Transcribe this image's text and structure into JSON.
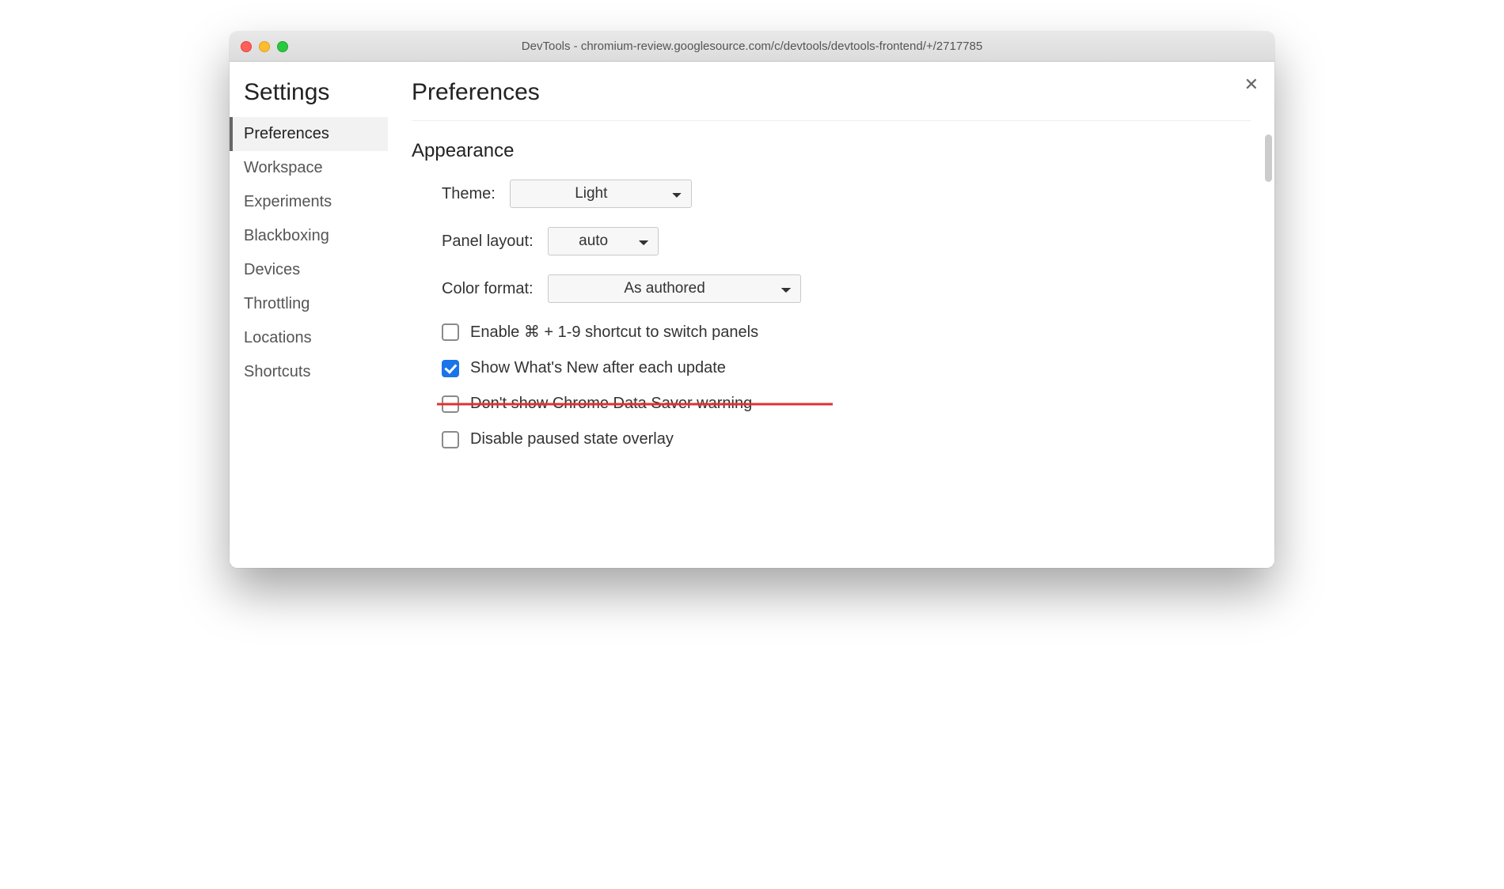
{
  "window": {
    "title": "DevTools - chromium-review.googlesource.com/c/devtools/devtools-frontend/+/2717785"
  },
  "sidebar": {
    "title": "Settings",
    "items": [
      {
        "label": "Preferences",
        "active": true
      },
      {
        "label": "Workspace"
      },
      {
        "label": "Experiments"
      },
      {
        "label": "Blackboxing"
      },
      {
        "label": "Devices"
      },
      {
        "label": "Throttling"
      },
      {
        "label": "Locations"
      },
      {
        "label": "Shortcuts"
      }
    ]
  },
  "main": {
    "title": "Preferences",
    "section_title": "Appearance",
    "theme_label": "Theme:",
    "theme_value": "Light",
    "panel_label": "Panel layout:",
    "panel_value": "auto",
    "color_label": "Color format:",
    "color_value": "As authored",
    "cb_shortcut": "Enable ⌘ + 1-9 shortcut to switch panels",
    "cb_whatsnew": "Show What's New after each update",
    "cb_datasaver": "Don't show Chrome Data Saver warning",
    "cb_paused": "Disable paused state overlay"
  }
}
